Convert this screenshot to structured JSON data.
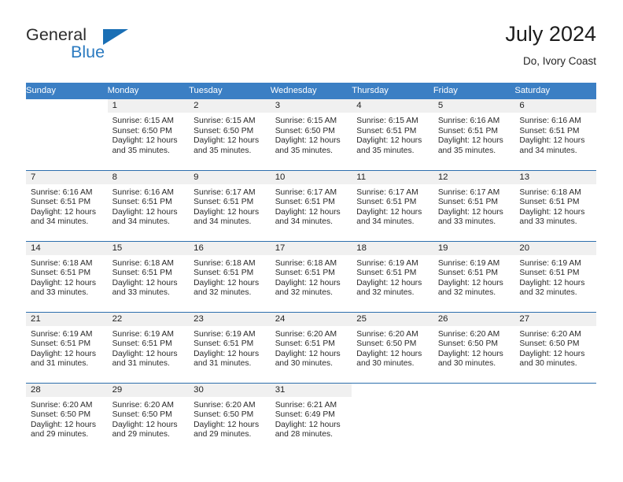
{
  "brand": {
    "name_dark": "General",
    "name_light": "Blue",
    "logo_icon": "triangle-icon"
  },
  "header": {
    "title": "July 2024",
    "location": "Do, Ivory Coast"
  },
  "calendar": {
    "weekday_headers": [
      "Sunday",
      "Monday",
      "Tuesday",
      "Wednesday",
      "Thursday",
      "Friday",
      "Saturday"
    ],
    "colors": {
      "header_bg": "#3b7fc4",
      "header_text": "#ffffff",
      "row_divider": "#2d6fad",
      "daynum_band": "#f0f0f0",
      "brand_blue": "#2a7ac0"
    },
    "weeks": [
      [
        {
          "day": "",
          "sunrise": "",
          "sunset": "",
          "daylight_line1": "",
          "daylight_line2": "",
          "blank": true
        },
        {
          "day": "1",
          "sunrise": "Sunrise: 6:15 AM",
          "sunset": "Sunset: 6:50 PM",
          "daylight_line1": "Daylight: 12 hours",
          "daylight_line2": "and 35 minutes."
        },
        {
          "day": "2",
          "sunrise": "Sunrise: 6:15 AM",
          "sunset": "Sunset: 6:50 PM",
          "daylight_line1": "Daylight: 12 hours",
          "daylight_line2": "and 35 minutes."
        },
        {
          "day": "3",
          "sunrise": "Sunrise: 6:15 AM",
          "sunset": "Sunset: 6:50 PM",
          "daylight_line1": "Daylight: 12 hours",
          "daylight_line2": "and 35 minutes."
        },
        {
          "day": "4",
          "sunrise": "Sunrise: 6:15 AM",
          "sunset": "Sunset: 6:51 PM",
          "daylight_line1": "Daylight: 12 hours",
          "daylight_line2": "and 35 minutes."
        },
        {
          "day": "5",
          "sunrise": "Sunrise: 6:16 AM",
          "sunset": "Sunset: 6:51 PM",
          "daylight_line1": "Daylight: 12 hours",
          "daylight_line2": "and 35 minutes."
        },
        {
          "day": "6",
          "sunrise": "Sunrise: 6:16 AM",
          "sunset": "Sunset: 6:51 PM",
          "daylight_line1": "Daylight: 12 hours",
          "daylight_line2": "and 34 minutes."
        }
      ],
      [
        {
          "day": "7",
          "sunrise": "Sunrise: 6:16 AM",
          "sunset": "Sunset: 6:51 PM",
          "daylight_line1": "Daylight: 12 hours",
          "daylight_line2": "and 34 minutes."
        },
        {
          "day": "8",
          "sunrise": "Sunrise: 6:16 AM",
          "sunset": "Sunset: 6:51 PM",
          "daylight_line1": "Daylight: 12 hours",
          "daylight_line2": "and 34 minutes."
        },
        {
          "day": "9",
          "sunrise": "Sunrise: 6:17 AM",
          "sunset": "Sunset: 6:51 PM",
          "daylight_line1": "Daylight: 12 hours",
          "daylight_line2": "and 34 minutes."
        },
        {
          "day": "10",
          "sunrise": "Sunrise: 6:17 AM",
          "sunset": "Sunset: 6:51 PM",
          "daylight_line1": "Daylight: 12 hours",
          "daylight_line2": "and 34 minutes."
        },
        {
          "day": "11",
          "sunrise": "Sunrise: 6:17 AM",
          "sunset": "Sunset: 6:51 PM",
          "daylight_line1": "Daylight: 12 hours",
          "daylight_line2": "and 34 minutes."
        },
        {
          "day": "12",
          "sunrise": "Sunrise: 6:17 AM",
          "sunset": "Sunset: 6:51 PM",
          "daylight_line1": "Daylight: 12 hours",
          "daylight_line2": "and 33 minutes."
        },
        {
          "day": "13",
          "sunrise": "Sunrise: 6:18 AM",
          "sunset": "Sunset: 6:51 PM",
          "daylight_line1": "Daylight: 12 hours",
          "daylight_line2": "and 33 minutes."
        }
      ],
      [
        {
          "day": "14",
          "sunrise": "Sunrise: 6:18 AM",
          "sunset": "Sunset: 6:51 PM",
          "daylight_line1": "Daylight: 12 hours",
          "daylight_line2": "and 33 minutes."
        },
        {
          "day": "15",
          "sunrise": "Sunrise: 6:18 AM",
          "sunset": "Sunset: 6:51 PM",
          "daylight_line1": "Daylight: 12 hours",
          "daylight_line2": "and 33 minutes."
        },
        {
          "day": "16",
          "sunrise": "Sunrise: 6:18 AM",
          "sunset": "Sunset: 6:51 PM",
          "daylight_line1": "Daylight: 12 hours",
          "daylight_line2": "and 32 minutes."
        },
        {
          "day": "17",
          "sunrise": "Sunrise: 6:18 AM",
          "sunset": "Sunset: 6:51 PM",
          "daylight_line1": "Daylight: 12 hours",
          "daylight_line2": "and 32 minutes."
        },
        {
          "day": "18",
          "sunrise": "Sunrise: 6:19 AM",
          "sunset": "Sunset: 6:51 PM",
          "daylight_line1": "Daylight: 12 hours",
          "daylight_line2": "and 32 minutes."
        },
        {
          "day": "19",
          "sunrise": "Sunrise: 6:19 AM",
          "sunset": "Sunset: 6:51 PM",
          "daylight_line1": "Daylight: 12 hours",
          "daylight_line2": "and 32 minutes."
        },
        {
          "day": "20",
          "sunrise": "Sunrise: 6:19 AM",
          "sunset": "Sunset: 6:51 PM",
          "daylight_line1": "Daylight: 12 hours",
          "daylight_line2": "and 32 minutes."
        }
      ],
      [
        {
          "day": "21",
          "sunrise": "Sunrise: 6:19 AM",
          "sunset": "Sunset: 6:51 PM",
          "daylight_line1": "Daylight: 12 hours",
          "daylight_line2": "and 31 minutes."
        },
        {
          "day": "22",
          "sunrise": "Sunrise: 6:19 AM",
          "sunset": "Sunset: 6:51 PM",
          "daylight_line1": "Daylight: 12 hours",
          "daylight_line2": "and 31 minutes."
        },
        {
          "day": "23",
          "sunrise": "Sunrise: 6:19 AM",
          "sunset": "Sunset: 6:51 PM",
          "daylight_line1": "Daylight: 12 hours",
          "daylight_line2": "and 31 minutes."
        },
        {
          "day": "24",
          "sunrise": "Sunrise: 6:20 AM",
          "sunset": "Sunset: 6:51 PM",
          "daylight_line1": "Daylight: 12 hours",
          "daylight_line2": "and 30 minutes."
        },
        {
          "day": "25",
          "sunrise": "Sunrise: 6:20 AM",
          "sunset": "Sunset: 6:50 PM",
          "daylight_line1": "Daylight: 12 hours",
          "daylight_line2": "and 30 minutes."
        },
        {
          "day": "26",
          "sunrise": "Sunrise: 6:20 AM",
          "sunset": "Sunset: 6:50 PM",
          "daylight_line1": "Daylight: 12 hours",
          "daylight_line2": "and 30 minutes."
        },
        {
          "day": "27",
          "sunrise": "Sunrise: 6:20 AM",
          "sunset": "Sunset: 6:50 PM",
          "daylight_line1": "Daylight: 12 hours",
          "daylight_line2": "and 30 minutes."
        }
      ],
      [
        {
          "day": "28",
          "sunrise": "Sunrise: 6:20 AM",
          "sunset": "Sunset: 6:50 PM",
          "daylight_line1": "Daylight: 12 hours",
          "daylight_line2": "and 29 minutes."
        },
        {
          "day": "29",
          "sunrise": "Sunrise: 6:20 AM",
          "sunset": "Sunset: 6:50 PM",
          "daylight_line1": "Daylight: 12 hours",
          "daylight_line2": "and 29 minutes."
        },
        {
          "day": "30",
          "sunrise": "Sunrise: 6:20 AM",
          "sunset": "Sunset: 6:50 PM",
          "daylight_line1": "Daylight: 12 hours",
          "daylight_line2": "and 29 minutes."
        },
        {
          "day": "31",
          "sunrise": "Sunrise: 6:21 AM",
          "sunset": "Sunset: 6:49 PM",
          "daylight_line1": "Daylight: 12 hours",
          "daylight_line2": "and 28 minutes."
        },
        {
          "day": "",
          "sunrise": "",
          "sunset": "",
          "daylight_line1": "",
          "daylight_line2": "",
          "blank": true
        },
        {
          "day": "",
          "sunrise": "",
          "sunset": "",
          "daylight_line1": "",
          "daylight_line2": "",
          "blank": true
        },
        {
          "day": "",
          "sunrise": "",
          "sunset": "",
          "daylight_line1": "",
          "daylight_line2": "",
          "blank": true
        }
      ]
    ]
  }
}
